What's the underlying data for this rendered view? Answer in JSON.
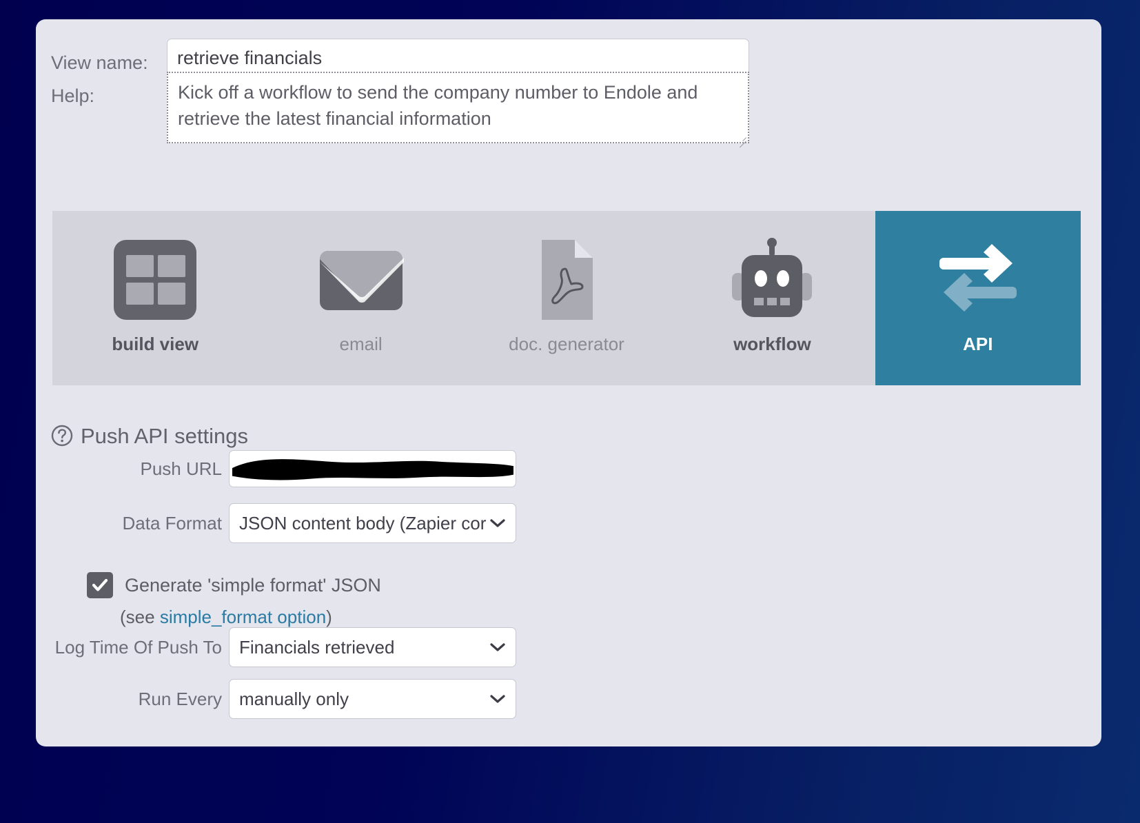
{
  "form": {
    "view_name_label": "View name:",
    "view_name_value": "retrieve financials",
    "help_label": "Help:",
    "help_value": "Kick off a workflow to send the company number to Endole and retrieve the latest financial information"
  },
  "tabs": [
    {
      "label": "build view",
      "icon": "grid-icon",
      "state": "selectable"
    },
    {
      "label": "email",
      "icon": "envelope-icon",
      "state": "dim"
    },
    {
      "label": "doc. generator",
      "icon": "pdf-file-icon",
      "state": "dim"
    },
    {
      "label": "workflow",
      "icon": "robot-icon",
      "state": "selectable"
    },
    {
      "label": "API",
      "icon": "api-arrows-icon",
      "state": "active"
    }
  ],
  "settings": {
    "title": "Push API settings",
    "help_icon": "question-circle-icon",
    "push_url_label": "Push URL",
    "push_url_value": "",
    "data_format_label": "Data Format",
    "data_format_value": "JSON content body (Zapier cor",
    "simple_json_label": "Generate 'simple format' JSON",
    "simple_json_checked": true,
    "simple_note_prefix": "(see ",
    "simple_note_link": "simple_format option",
    "simple_note_suffix": ")",
    "log_time_label": "Log Time Of Push To",
    "log_time_value": "Financials retrieved",
    "run_every_label": "Run Every",
    "run_every_value": "manually only"
  },
  "colors": {
    "page_background": "#00004f",
    "panel_background": "#e4e5ed",
    "tabstrip_background": "#d4d5dc",
    "active_tab": "#2e7fa0",
    "link": "#2a7ba3",
    "icon_dark": "#5d5d65",
    "icon_light": "#a9aab2"
  }
}
